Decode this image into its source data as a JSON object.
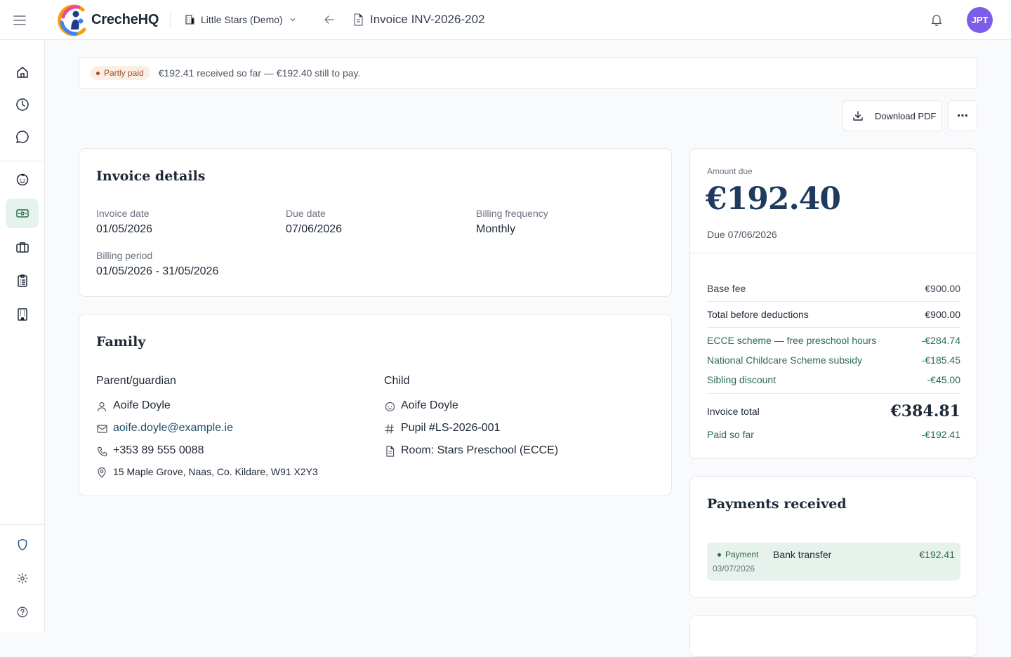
{
  "app": {
    "brand": "CrecheHQ",
    "org": "Little Stars (Demo)",
    "page_title": "Invoice INV-2026-202",
    "user_initials": "JPT"
  },
  "colors": {
    "accent_green": "#2b6b50",
    "navy": "#1e3a5f",
    "avatar": "#7c5ce8",
    "partly_paid_badge": "#fbeee2"
  },
  "sidebar": {
    "items": [
      {
        "name": "home-icon"
      },
      {
        "name": "clock-icon"
      },
      {
        "name": "chat-icon"
      },
      {
        "name": "baby-icon"
      },
      {
        "name": "money-icon",
        "active": true
      },
      {
        "name": "briefcase-icon"
      },
      {
        "name": "clipboard-icon"
      },
      {
        "name": "building-icon"
      }
    ],
    "bottom": [
      {
        "name": "shield-icon"
      },
      {
        "name": "gear-icon"
      },
      {
        "name": "help-icon"
      }
    ]
  },
  "banner": {
    "badge": "Partly paid",
    "text": "€192.41 received so far — €192.40 still to pay."
  },
  "actions": {
    "download": "Download PDF",
    "more": "⋯"
  },
  "invoice_details": {
    "title": "Invoice details",
    "invoice_date_label": "Invoice date",
    "invoice_date": "01/05/2026",
    "due_date_label": "Due date",
    "due_date": "07/06/2026",
    "billing_frequency_label": "Billing frequency",
    "billing_frequency": "Monthly",
    "billing_period_label": "Billing period",
    "billing_period": "01/05/2026 - 31/05/2026"
  },
  "family": {
    "title": "Family",
    "parent_heading": "Parent/guardian",
    "parent_name": "Aoife Doyle",
    "parent_email": "aoife.doyle@example.ie",
    "parent_phone": "+353 89 555 0088",
    "parent_address": "15 Maple Grove, Naas, Co. Kildare, W91 X2Y3",
    "child_heading": "Child",
    "child_name": "Aoife Doyle",
    "child_pupil": "Pupil #LS-2026-001",
    "child_room": "Room: Stars Preschool (ECCE)"
  },
  "summary": {
    "amount_due_label": "Amount due",
    "amount_due": "€192.40",
    "due": "Due 07/06/2026",
    "base_fee_label": "Base fee",
    "base_fee": "€900.00",
    "total_before_label": "Total before deductions",
    "total_before": "€900.00",
    "ecce_label": "ECCE scheme — free preschool hours",
    "ecce": "-€284.74",
    "ncs_label": "National Childcare Scheme subsidy",
    "ncs": "-€185.45",
    "sibling_label": "Sibling discount",
    "sibling": "-€45.00",
    "invoice_total_label": "Invoice total",
    "invoice_total": "€384.81",
    "paid_label": "Paid so far",
    "paid": "-€192.41"
  },
  "payments": {
    "title": "Payments received",
    "items": [
      {
        "badge": "Payment",
        "method": "Bank transfer",
        "amount": "€192.41",
        "date": "03/07/2026"
      }
    ]
  }
}
